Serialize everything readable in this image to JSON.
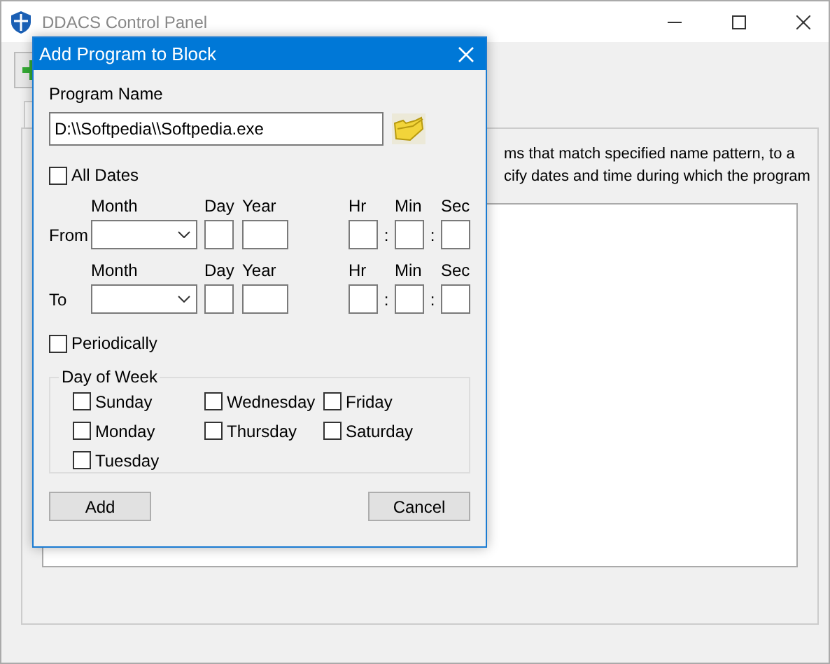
{
  "window": {
    "title": "DDACS Control Panel"
  },
  "description_lines": [
    "ms that match specified name pattern, to a",
    "cify dates and time during which the program"
  ],
  "dialog": {
    "title": "Add Program to Block",
    "program_name_label": "Program Name",
    "program_name_value": "D:\\\\Softpedia\\\\Softpedia.exe",
    "all_dates": {
      "label": "All Dates",
      "checked": false
    },
    "ranges": [
      {
        "label": "From",
        "month_label": "Month",
        "day_label": "Day",
        "year_label": "Year",
        "hr_label": "Hr",
        "min_label": "Min",
        "sec_label": "Sec",
        "separators": [
          ":",
          ":"
        ]
      },
      {
        "label": "To",
        "month_label": "Month",
        "day_label": "Day",
        "year_label": "Year",
        "hr_label": "Hr",
        "min_label": "Min",
        "sec_label": "Sec",
        "separators": [
          ":",
          ":"
        ]
      }
    ],
    "periodically": {
      "label": "Periodically",
      "checked": false
    },
    "day_of_week": {
      "title": "Day of Week",
      "days": [
        {
          "label": "Sunday",
          "checked": false
        },
        {
          "label": "Wednesday",
          "checked": false
        },
        {
          "label": "Friday",
          "checked": false
        },
        {
          "label": "Monday",
          "checked": false
        },
        {
          "label": "Thursday",
          "checked": false
        },
        {
          "label": "Saturday",
          "checked": false
        },
        {
          "label": "Tuesday",
          "checked": false
        }
      ]
    },
    "buttons": [
      "Add",
      "Cancel"
    ]
  }
}
